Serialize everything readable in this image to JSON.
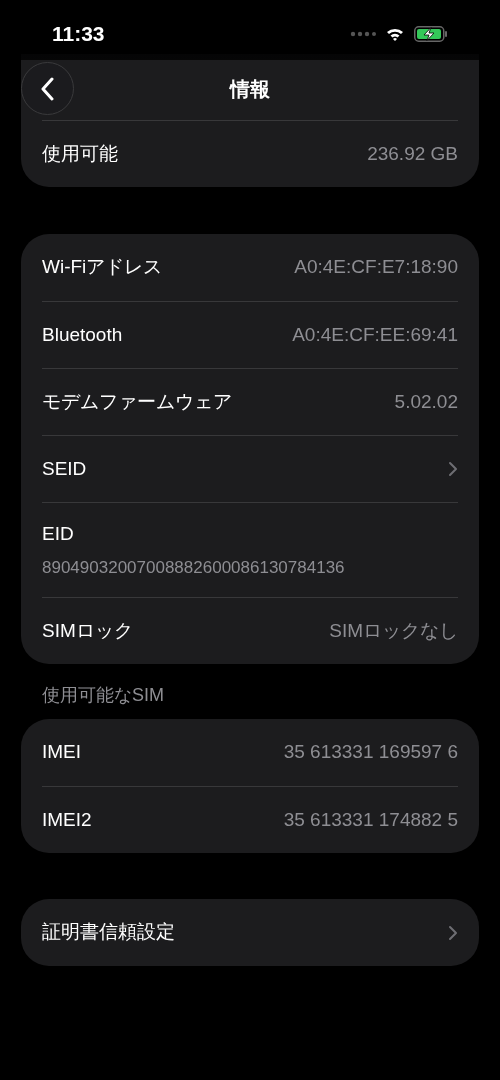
{
  "status_bar": {
    "time": "11:33"
  },
  "nav": {
    "title": "情報"
  },
  "sections": [
    {
      "rows": [
        {
          "kind": "value",
          "label": "使用可能",
          "value": "236.92 GB"
        }
      ]
    },
    {
      "rows": [
        {
          "kind": "value",
          "label": "Wi-Fiアドレス",
          "value": "A0:4E:CF:E7:18:90"
        },
        {
          "kind": "value",
          "label": "Bluetooth",
          "value": "A0:4E:CF:EE:69:41"
        },
        {
          "kind": "value",
          "label": "モデムファームウェア",
          "value": "5.02.02"
        },
        {
          "kind": "link",
          "label": "SEID"
        },
        {
          "kind": "stacked",
          "label": "EID",
          "value": "89049032007008882600086130784136"
        },
        {
          "kind": "value",
          "label": "SIMロック",
          "value": "SIMロックなし"
        }
      ]
    },
    {
      "header": "使用可能なSIM",
      "rows": [
        {
          "kind": "value",
          "label": "IMEI",
          "value": "35 613331 169597 6"
        },
        {
          "kind": "value",
          "label": "IMEI2",
          "value": "35 613331 174882 5"
        }
      ]
    },
    {
      "rows": [
        {
          "kind": "link",
          "label": "証明書信頼設定"
        }
      ]
    }
  ]
}
